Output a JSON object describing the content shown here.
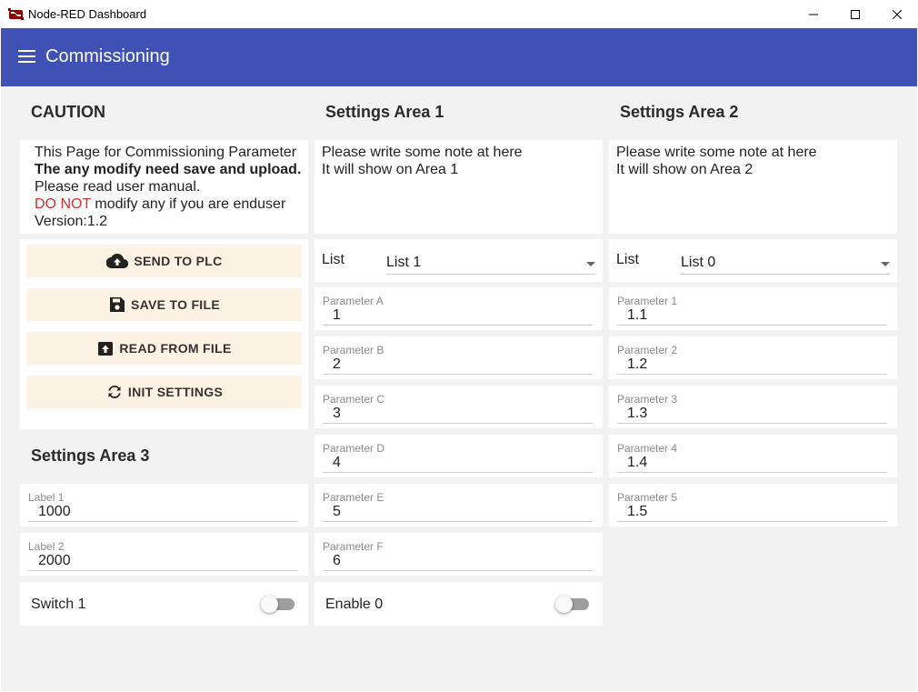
{
  "window": {
    "title": "Node-RED Dashboard"
  },
  "toolbar": {
    "title": "Commissioning"
  },
  "caution": {
    "title": "CAUTION",
    "line1": "This Page for Commissioning Parameter",
    "line2": "The any modify need save and upload.",
    "line3": "Please read user manual.",
    "line4_red": "DO NOT",
    "line4_rest": " modify any if you are enduser",
    "line5": "Version:1.2"
  },
  "buttons": {
    "send": "SEND TO PLC",
    "save": "SAVE TO FILE",
    "read": "READ FROM FILE",
    "init": "INIT SETTINGS"
  },
  "area3": {
    "title": "Settings Area 3",
    "label1": {
      "label": "Label 1",
      "value": "1000"
    },
    "label2": {
      "label": "Label 2",
      "value": "2000"
    },
    "switch": {
      "label": "Switch 1",
      "on": false
    }
  },
  "area1": {
    "title": "Settings Area 1",
    "note_line1": "Please write some note at here",
    "note_line2": "It will show on Area 1",
    "list": {
      "label": "List",
      "value": "List 1"
    },
    "params": [
      {
        "label": "Parameter A",
        "value": "1"
      },
      {
        "label": "Parameter B",
        "value": "2"
      },
      {
        "label": "Parameter C",
        "value": "3"
      },
      {
        "label": "Parameter D",
        "value": "4"
      },
      {
        "label": "Parameter E",
        "value": "5"
      },
      {
        "label": "Parameter F",
        "value": "6"
      }
    ],
    "switch": {
      "label": "Enable 0",
      "on": false
    }
  },
  "area2": {
    "title": "Settings Area 2",
    "note_line1": "Please write some note at here",
    "note_line2": "It will show on Area 2",
    "list": {
      "label": "List",
      "value": "List 0"
    },
    "params": [
      {
        "label": "Parameter 1",
        "value": "1.1"
      },
      {
        "label": "Parameter 2",
        "value": "1.2"
      },
      {
        "label": "Parameter 3",
        "value": "1.3"
      },
      {
        "label": "Parameter 4",
        "value": "1.4"
      },
      {
        "label": "Parameter 5",
        "value": "1.5"
      }
    ]
  },
  "colors": {
    "toolbar": "#3f51b5",
    "button_bg": "#fdf3e5",
    "warning": "#d32f2f",
    "page_bg": "#f2f2f2"
  }
}
